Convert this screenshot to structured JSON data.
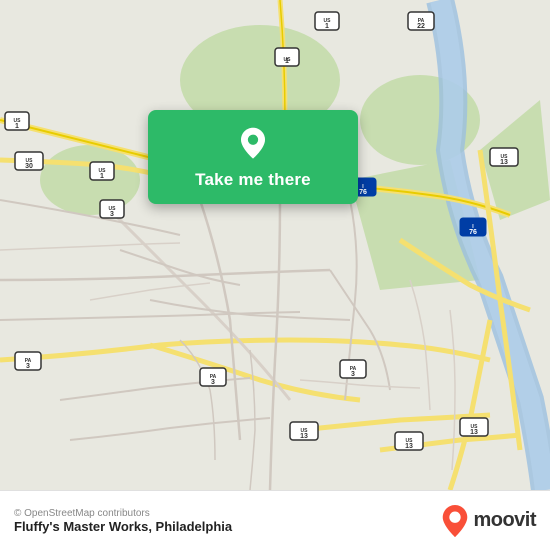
{
  "map": {
    "background_color": "#e8e0d8",
    "alt": "Map of Philadelphia area"
  },
  "button": {
    "label": "Take me there",
    "bg_color": "#2dba68"
  },
  "bottom_bar": {
    "location_name": "Fluffy's Master Works, Philadelphia",
    "osm_credit": "© OpenStreetMap contributors",
    "moovit_label": "moovit"
  }
}
